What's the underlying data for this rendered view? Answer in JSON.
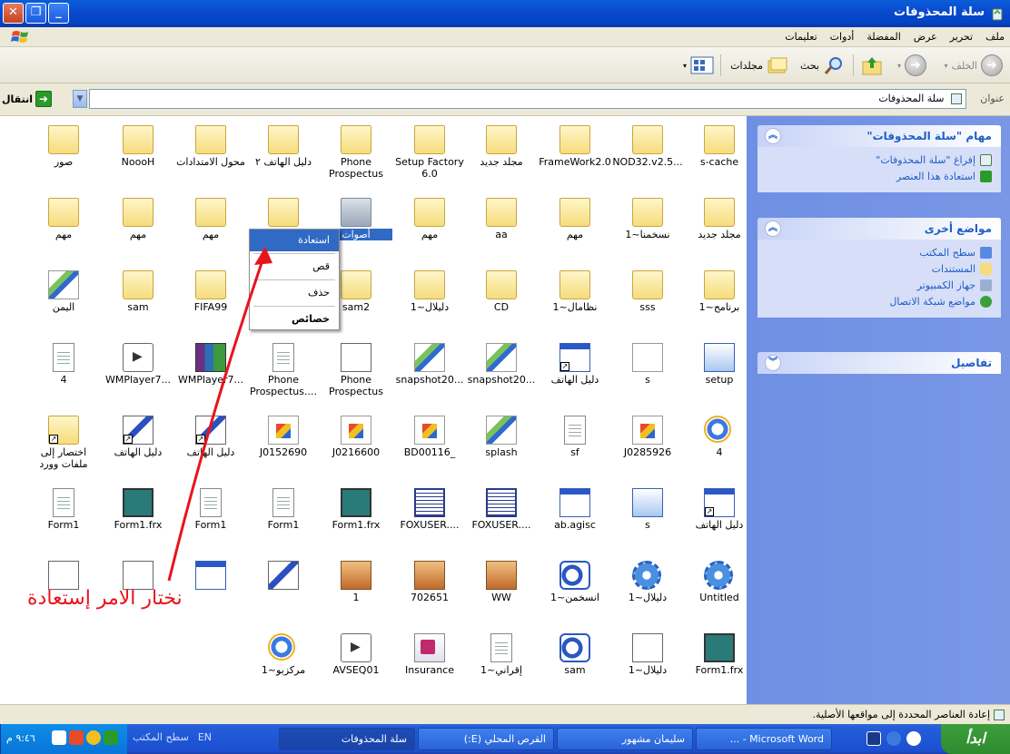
{
  "window": {
    "title": "سلة المحذوفات",
    "controls": {
      "close": "✕",
      "maximize": "❐",
      "minimize": "_"
    }
  },
  "menubar": {
    "items": [
      "ملف",
      "تحرير",
      "عرض",
      "المفضلة",
      "أدوات",
      "تعليمات"
    ]
  },
  "toolbar": {
    "back_label": "الخلف",
    "search_label": "بحث",
    "folders_label": "مجلدات"
  },
  "addressbar": {
    "label": "عنوان",
    "value": "سلة المحذوفات",
    "go_label": "انتقال"
  },
  "taskpane": {
    "tasks_title": "مهام \"سلة المحذوفات\"",
    "tasks": [
      "إفراغ \"سلة المحذوفات\"",
      "استعادة هذا العنصر"
    ],
    "other_title": "مواضع أخرى",
    "other": [
      "سطح المكتب",
      "المستندات",
      "جهاز الكمبيوتر",
      "مواضع شبكة الاتصال"
    ],
    "details_title": "تفاصيل"
  },
  "items": [
    [
      "s-cache",
      "NOD32.v2.5...",
      "FrameWork2.0",
      "مجلد جديد",
      "Setup Factory 6.0",
      "Phone Prospectus",
      "دليل الهاتف ٢",
      "محول الامتدادات",
      "NoooH",
      "صور"
    ],
    [
      "مجلد جديد",
      "نسخمنا~1",
      "مهم",
      "aa",
      "مهم",
      "أصوات",
      "Ph",
      "مهم",
      "مهم",
      "مهم"
    ],
    [
      "برنامج~1",
      "sss",
      "نظامال~1",
      "CD",
      "دليلال~1",
      "sam2",
      "",
      "FIFA99",
      "sam",
      "اليمن"
    ],
    [
      "setup",
      "s",
      "دليل الهاتف",
      "snapshot20...",
      "snapshot20...",
      "Phone Prospectus",
      "Phone Prospectus....",
      "WMPlayer7...",
      "WMPlayer7...",
      "4"
    ],
    [
      "4",
      "J0285926",
      "sf",
      "splash",
      "BD00116_",
      "J0216600",
      "J0152690",
      "دليل الهاتف",
      "دليل الهاتف",
      "اختصار إلى ملفات وورد"
    ],
    [
      "دليل الهاتف",
      "s",
      "ab.agisc",
      "FOXUSER....",
      "FOXUSER....",
      "Form1.frx",
      "Form1",
      "Form1",
      "Form1.frx",
      "Form1"
    ],
    [
      "Untitled",
      "دليلال~1",
      "انسخمن~1",
      "WW",
      "702651",
      "1",
      "",
      "",
      "",
      ""
    ],
    [
      "Form1.frx",
      "دليلال~1",
      "sam",
      "إقراني~1",
      "Insurance",
      "AVSEQ01",
      "مركزبو~1",
      "",
      "",
      ""
    ]
  ],
  "context_menu": {
    "items": [
      "استعادة",
      "قص",
      "حذف",
      "خصائص"
    ]
  },
  "annotation": {
    "text": "نختار الامر إستعادة"
  },
  "statusbar": {
    "text": "إعادة العناصر المحددة إلى مواقعها الأصلية."
  },
  "taskbar": {
    "start_label": "ابدأ",
    "tasks": [
      "Microsoft Word - ...",
      "سليمان مشهور",
      "القرص المحلي (E:)",
      "سلة المحذوفات"
    ],
    "desktop_label": "سطح المكتب",
    "lang": "EN",
    "clock": "٩:٤٦ م"
  },
  "colors": {
    "title_blue": "#0a4ad0",
    "taskpane_blue": "#7a97e6",
    "selection": "#316ac5",
    "annotation_red": "#e8141c"
  }
}
